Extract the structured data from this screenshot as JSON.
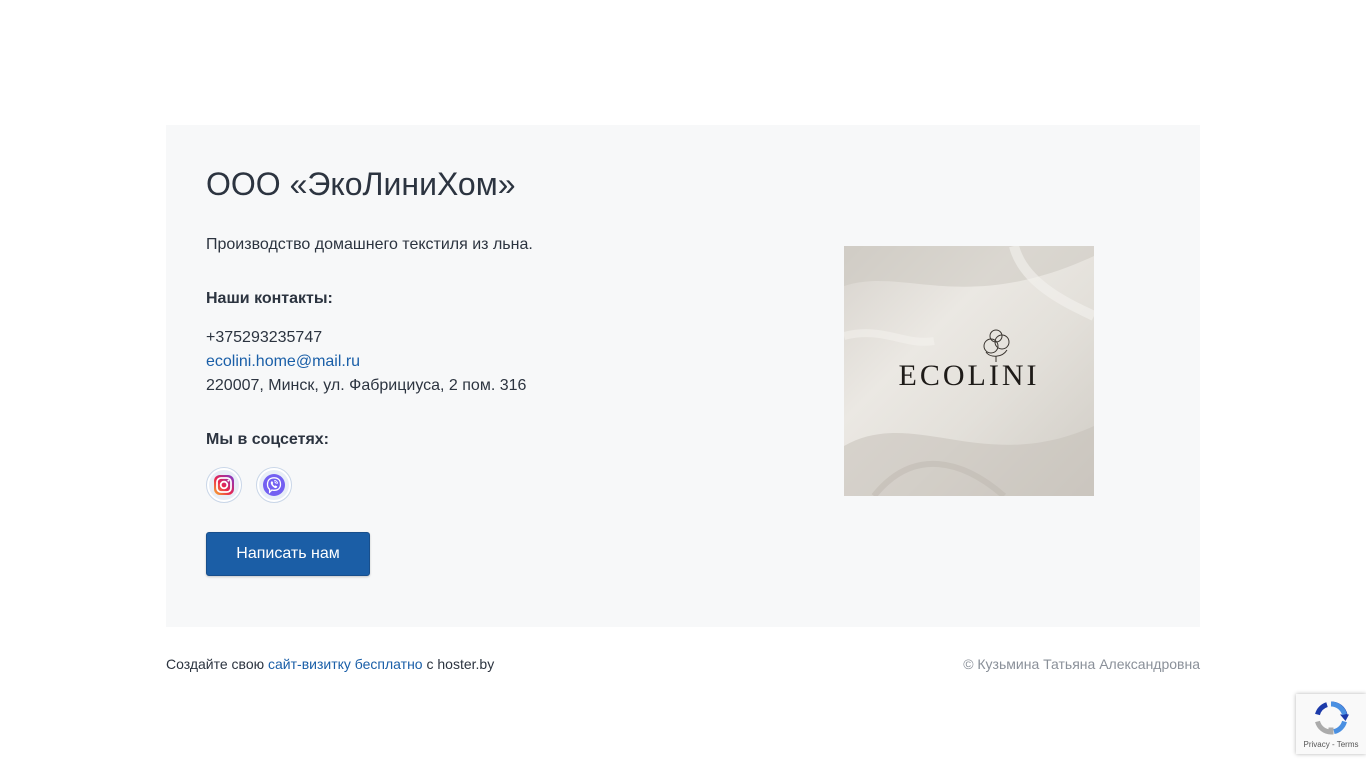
{
  "company": {
    "title": "ООО «ЭкоЛиниХом»",
    "description": "Производство домашнего текстиля из льна."
  },
  "contacts": {
    "heading": "Наши контакты:",
    "phone": "+375293235747",
    "email": "ecolini.home@mail.ru",
    "address": "220007, Минск, ул. Фабрициуса, 2 пом. 316"
  },
  "social": {
    "heading": "Мы в соцсетях:",
    "icons": [
      "instagram-icon",
      "viber-icon"
    ]
  },
  "contact_button": {
    "label": "Написать нам"
  },
  "brand_image": {
    "logo_text": "ECOLINI"
  },
  "footer": {
    "prefix": "Создайте свою",
    "link_label": "сайт-визитку бесплатно",
    "suffix": "с hoster.by",
    "copyright": "© Кузьмина Татьяна Александровна"
  },
  "recaptcha": {
    "privacy_label": "Privacy",
    "separator": " - ",
    "terms_label": "Terms"
  },
  "colors": {
    "accent": "#1b5ea6",
    "link": "#1a5fa8",
    "card_background": "#f7f8f9",
    "muted_text": "#8a9099"
  }
}
